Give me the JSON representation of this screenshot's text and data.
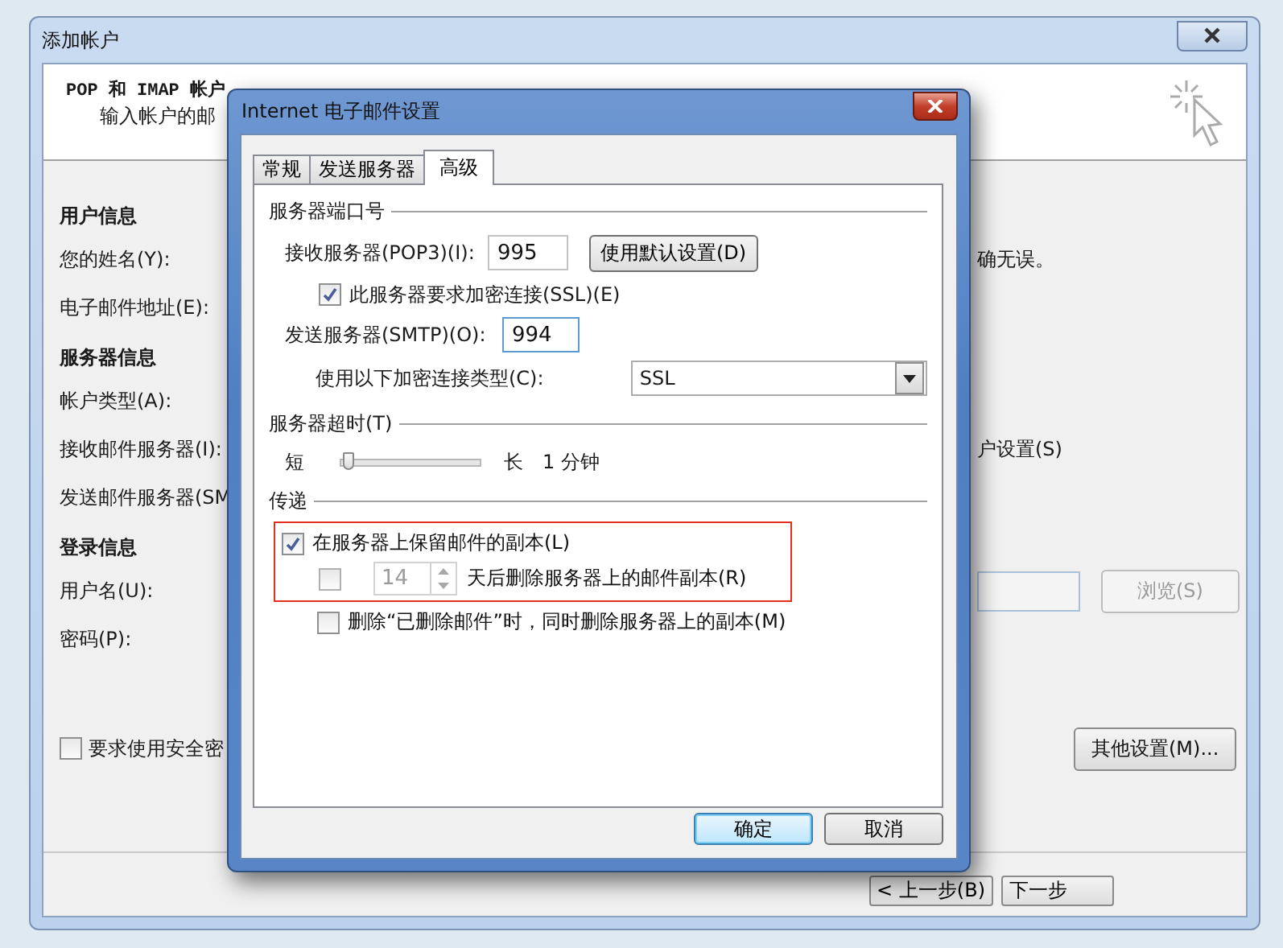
{
  "window": {
    "title": "添加帐户"
  },
  "header": {
    "title": "POP 和 IMAP 帐户",
    "subtitle": "输入帐户的邮"
  },
  "form_rows": [
    {
      "kind": "heading",
      "label": "用户信息"
    },
    {
      "kind": "label",
      "label": "您的姓名(Y):",
      "right": {
        "kind": "text",
        "text": "确无误。"
      }
    },
    {
      "kind": "label",
      "label": "电子邮件地址(E):"
    },
    {
      "kind": "heading",
      "label": "服务器信息"
    },
    {
      "kind": "label",
      "label": "帐户类型(A):"
    },
    {
      "kind": "label",
      "label": "接收邮件服务器(I):",
      "right": {
        "kind": "text",
        "text": "户设置(S)"
      }
    },
    {
      "kind": "label",
      "label": "发送邮件服务器(SM"
    },
    {
      "kind": "heading",
      "label": "登录信息"
    },
    {
      "kind": "label",
      "label": "用户名(U):",
      "right": {
        "kind": "browse",
        "button": "浏览(S)",
        "disabled": true
      }
    },
    {
      "kind": "label",
      "label": "密码(P):"
    },
    {
      "kind": "checkbox",
      "label": "要求使用安全密",
      "checked": false,
      "right": {
        "kind": "button",
        "button": "其他设置(M)..."
      }
    }
  ],
  "nav_buttons": [
    {
      "label": "< 上一步(B)"
    },
    {
      "label": "下一步"
    }
  ],
  "dialog": {
    "title": "Internet 电子邮件设置",
    "tabs": [
      {
        "label": "常规",
        "selected": false
      },
      {
        "label": "发送服务器",
        "selected": false
      },
      {
        "label": "高级",
        "selected": true
      }
    ],
    "ports": {
      "heading": "服务器端口号",
      "incoming_label": "接收服务器(POP3)(I):",
      "incoming_value": "995",
      "default_button": "使用默认设置(D)",
      "ssl": {
        "label": "此服务器要求加密连接(SSL)(E)",
        "checked": true
      },
      "outgoing_label": "发送服务器(SMTP)(O):",
      "outgoing_value": "994",
      "encryption_label": "使用以下加密连接类型(C):",
      "encryption_value": "SSL"
    },
    "timeout": {
      "heading": "服务器超时(T)",
      "min_label": "短",
      "max_label": "长",
      "level": 0.05,
      "reading": "1 分钟"
    },
    "delivery": {
      "heading": "传递",
      "options": [
        {
          "kind": "checkbox",
          "label": "在服务器上保留邮件的副本(L)",
          "checked": true,
          "disabled": false,
          "highlighted": true
        },
        {
          "kind": "days",
          "value": "14",
          "suffix": "天后删除服务器上的邮件副本(R)",
          "checked": false,
          "disabled": true,
          "highlighted": true
        },
        {
          "kind": "checkbox",
          "label": "删除“已删除邮件”时，同时删除服务器上的副本(M)",
          "checked": false,
          "disabled": false,
          "highlighted": false
        }
      ]
    },
    "buttons": [
      {
        "label": "确定",
        "default": true
      },
      {
        "label": "取消",
        "default": false
      }
    ]
  }
}
